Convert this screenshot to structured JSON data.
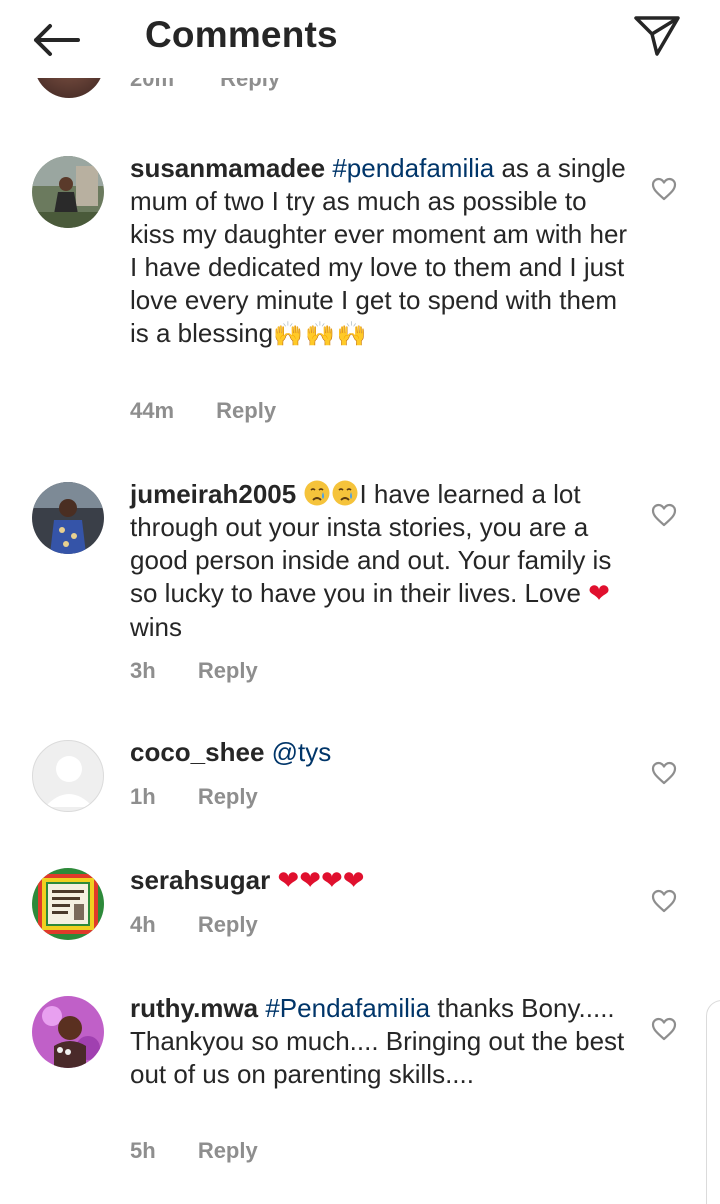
{
  "header": {
    "title": "Comments"
  },
  "previous": {
    "time": "20m",
    "reply": "Reply"
  },
  "comments": [
    {
      "username": "susanmamadee",
      "tag": "#pendafamilia",
      "text": "as a single mum of two I try as much as possible to kiss my daughter ever moment am with her I have dedicated my love to them and I just love every minute I get to spend with them is a blessing",
      "emoji": "🙌🙌🙌",
      "time": "44m",
      "reply": "Reply"
    },
    {
      "username": "jumeirah2005",
      "text_before": "I have learned a lot through out your insta stories, you are a good person inside and out. Your family is so lucky to have you in their lives. Love",
      "heart": "❤",
      "text_after": "wins",
      "time": "3h",
      "reply": "Reply"
    },
    {
      "username": "coco_shee",
      "mention": "@tys",
      "time": "1h",
      "reply": "Reply"
    },
    {
      "username": "serahsugar",
      "hearts": "❤❤❤❤",
      "time": "4h",
      "reply": "Reply"
    },
    {
      "username": "ruthy.mwa",
      "tag": "#Pendafamilia",
      "text": "thanks Bony..... Thankyou so much.... Bringing out the best out of us on parenting skills....",
      "time": "5h",
      "reply": "Reply"
    }
  ],
  "colors": {
    "text": "#262626",
    "muted": "#8e8e8e",
    "link": "#003569",
    "heart": "#e0102e"
  }
}
